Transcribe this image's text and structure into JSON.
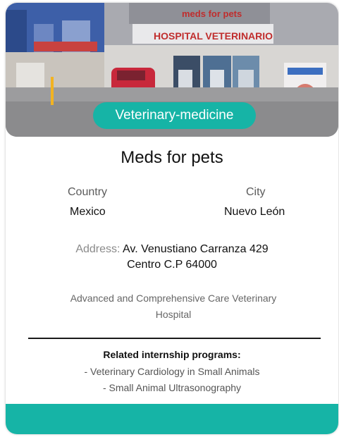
{
  "card": {
    "category": "Veterinary-medicine",
    "photo": {
      "description": "clinic-storefront-photo",
      "sign_text": "HOSPITAL VETERINARIO",
      "roof_text": "meds for pets"
    },
    "title": "Meds for pets",
    "country": {
      "label": "Country",
      "value": "Mexico"
    },
    "city": {
      "label": "City",
      "value": "Nuevo León"
    },
    "address": {
      "label": "Address:",
      "line1": "Av. Venustiano Carranza 429",
      "line2": "Centro C.P 64000"
    },
    "description": "Advanced and Comprehensive Care Veterinary Hospital",
    "programs": {
      "heading": "Related internship programs:",
      "items": [
        "- Veterinary Cardiology in Small Animals",
        "- Small Animal Ultrasonography"
      ]
    }
  },
  "colors": {
    "accent": "#16b4a6",
    "title_text": "#111111",
    "muted_text": "#666666"
  }
}
